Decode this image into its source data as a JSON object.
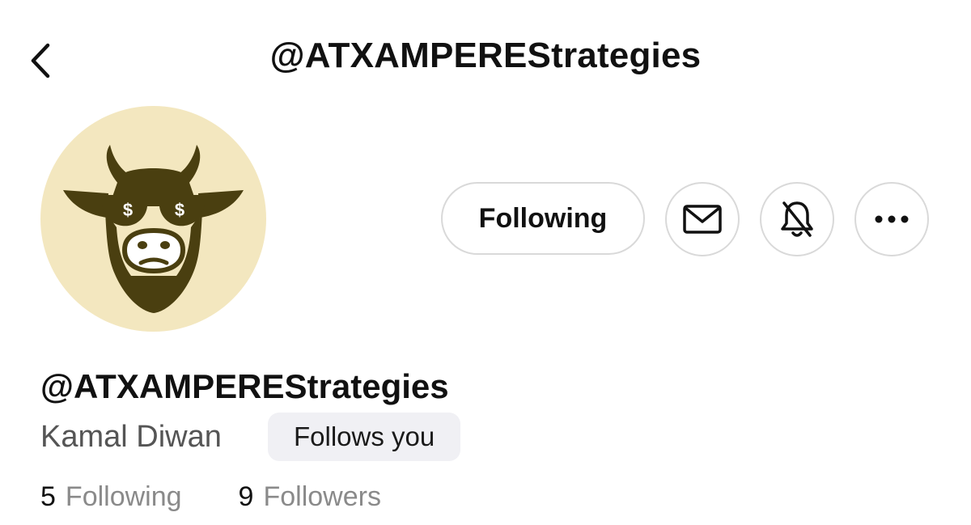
{
  "header": {
    "title": "@ATXAMPEREStrategies"
  },
  "profile": {
    "handle": "@ATXAMPEREStrategies",
    "display_name": "Kamal Diwan",
    "follows_you_badge": "Follows you",
    "avatar_description_icon": "bull-sunglasses-avatar"
  },
  "actions": {
    "following_label": "Following",
    "message_icon": "mail-icon",
    "notifications_icon": "bell-off-icon",
    "more_icon": "more-horizontal-icon"
  },
  "stats": {
    "following_count": "5",
    "following_label": "Following",
    "followers_count": "9",
    "followers_label": "Followers"
  },
  "colors": {
    "avatar_bg": "#f3e7bf",
    "avatar_fg": "#4a3f10",
    "border": "#d9d9d9",
    "badge_bg": "#f0f0f4",
    "muted_text": "#8a8a8a"
  }
}
